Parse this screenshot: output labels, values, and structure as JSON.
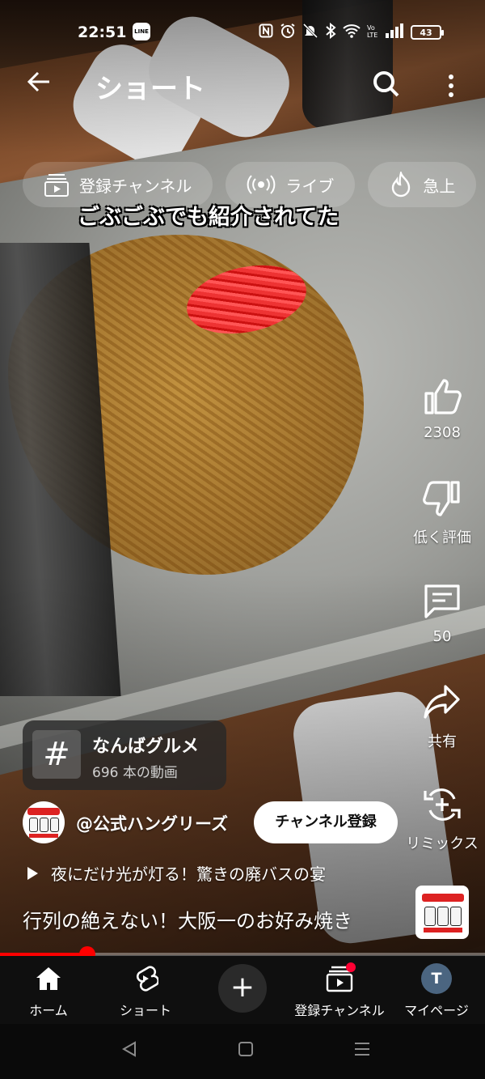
{
  "status_bar": {
    "time": "22:51",
    "line_badge": "LINE",
    "battery": "43"
  },
  "header": {
    "title": "ショート"
  },
  "chips": [
    {
      "label": "登録チャンネル",
      "icon": "subscriptions-icon"
    },
    {
      "label": "ライブ",
      "icon": "live-icon"
    },
    {
      "label": "急上",
      "icon": "trending-icon"
    }
  ],
  "video": {
    "caption": "ごぶごぶでも紹介されてた",
    "progress": 0.18
  },
  "actions": {
    "like_count": "2308",
    "dislike_label": "低く評価",
    "comment_count": "50",
    "share_label": "共有",
    "remix_label": "リミックス"
  },
  "hashtag": {
    "symbol": "#",
    "title": "なんばグルメ",
    "subtitle": "696 本の動画"
  },
  "channel": {
    "name": "@公式ハングリーズ",
    "subscribe_label": "チャンネル登録"
  },
  "playlist": {
    "label": "夜にだけ光が灯る！驚きの廃バスの宴"
  },
  "title": "行列の絶えない！大阪一のお好み焼き",
  "bottom_nav": {
    "home": "ホーム",
    "shorts": "ショート",
    "create": "+",
    "subscriptions": "登録チャンネル",
    "mypage": "マイページ",
    "avatar_letter": "T"
  },
  "colors": {
    "accent_red": "#ff0000",
    "nav_bg": "#0f0f0f",
    "chip_bg": "rgba(255,255,255,0.16)"
  }
}
